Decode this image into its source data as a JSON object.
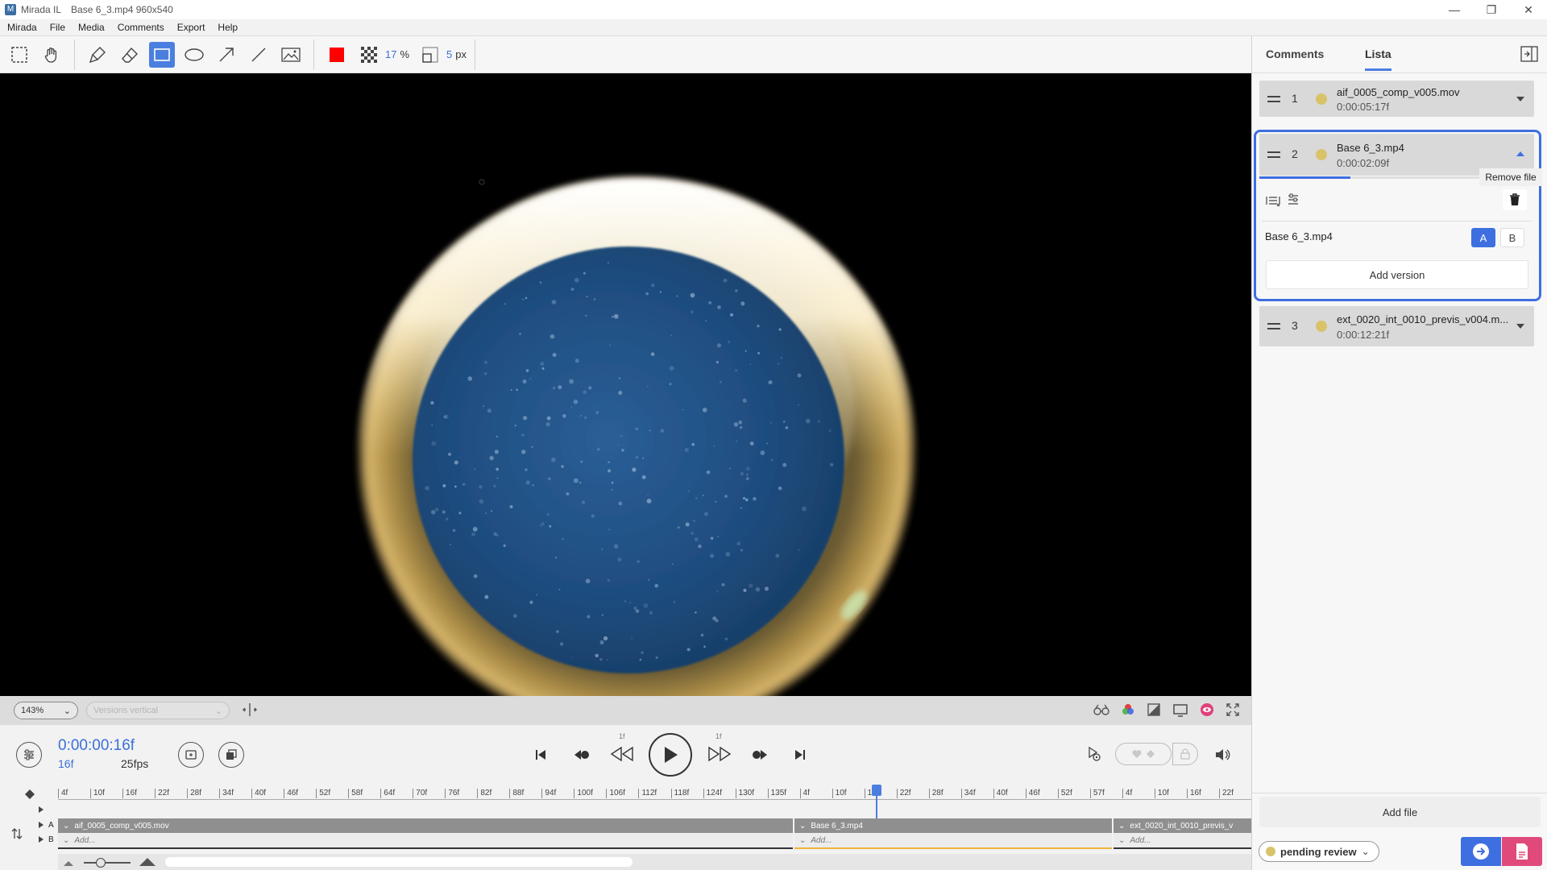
{
  "window": {
    "app_name": "Mirada IL",
    "file_title": "Base 6_3.mp4 960x540"
  },
  "menu": [
    "Mirada",
    "File",
    "Media",
    "Comments",
    "Export",
    "Help"
  ],
  "toolbar": {
    "color": "#ff0000",
    "opacity_value": "17",
    "opacity_unit": "%",
    "stroke_value": "5",
    "stroke_unit": "px"
  },
  "viewbar": {
    "zoom": "143%",
    "layout_select": "Versions vertical"
  },
  "transport": {
    "timecode": "0:00:00:16f",
    "frame": "16f",
    "fps": "25fps",
    "step_back_label": "1f",
    "step_fwd_label": "1f"
  },
  "timeline": {
    "ruler_ticks": [
      "4f",
      "10f",
      "16f",
      "22f",
      "28f",
      "34f",
      "40f",
      "46f",
      "52f",
      "58f",
      "64f",
      "70f",
      "76f",
      "82f",
      "88f",
      "94f",
      "100f",
      "106f",
      "112f",
      "118f",
      "124f",
      "130f",
      "135f",
      "4f",
      "10f",
      "16f",
      "22f",
      "28f",
      "34f",
      "40f",
      "46f",
      "52f",
      "57f",
      "4f",
      "10f",
      "16f",
      "22f"
    ],
    "track_a_label": "A",
    "track_b_label": "B",
    "clips": [
      {
        "name": "aif_0005_comp_v005.mov",
        "add": "Add..."
      },
      {
        "name": "Base 6_3.mp4",
        "add": "Add..."
      },
      {
        "name": "ext_0020_int_0010_previs_v",
        "add": "Add..."
      }
    ]
  },
  "panel": {
    "tabs": [
      "Comments",
      "Lista"
    ],
    "active_tab": "Lista",
    "items": [
      {
        "index": "1",
        "name": "aif_0005_comp_v005.mov",
        "duration": "0:00:05:17f",
        "status_color": "#d9c36a"
      },
      {
        "index": "2",
        "name": "Base 6_3.mp4",
        "duration": "0:00:02:09f",
        "status_color": "#d9c36a",
        "progress": 0.33
      },
      {
        "index": "3",
        "name": "ext_0020_int_0010_previs_v004.m...",
        "duration": "0:00:12:21f",
        "status_color": "#d9c36a"
      }
    ],
    "tooltip": "Remove file",
    "version_name": "Base 6_3.mp4",
    "version_a": "A",
    "version_b": "B",
    "add_version": "Add version",
    "add_file": "Add file",
    "status": "pending review",
    "status_color": "#d9c36a",
    "accent": "#4a7fe0"
  }
}
